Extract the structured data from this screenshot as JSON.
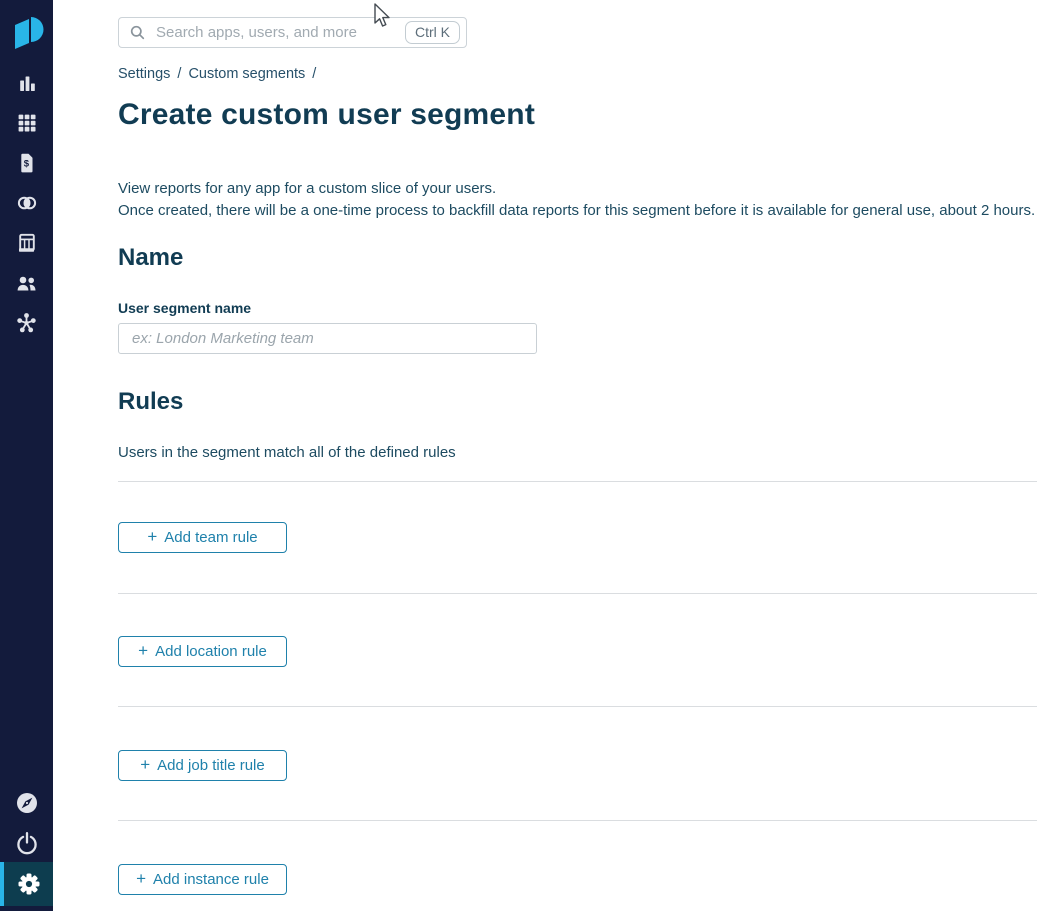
{
  "colors": {
    "sidebar_bg": "#131b3c",
    "sidebar_active_bg": "#0d3d4f",
    "accent_cyan": "#29b5e8",
    "heading_text": "#113c53",
    "body_text": "#1d4b61",
    "button_blue": "#1f81ab",
    "divider": "#dadde0"
  },
  "sidebar": {
    "logo_icon": "productiv-logo",
    "items": [
      {
        "id": "analytics",
        "icon": "bar-chart-icon"
      },
      {
        "id": "apps",
        "icon": "apps-grid-icon"
      },
      {
        "id": "spend",
        "icon": "invoice-dollar-icon"
      },
      {
        "id": "overlaps",
        "icon": "venn-diagram-icon"
      },
      {
        "id": "contracts",
        "icon": "receipt-icon"
      },
      {
        "id": "users",
        "icon": "users-icon"
      },
      {
        "id": "integrations",
        "icon": "hub-icon"
      }
    ],
    "footer_items": [
      {
        "id": "explore",
        "icon": "compass-icon",
        "active": false
      },
      {
        "id": "power",
        "icon": "power-icon",
        "active": false
      },
      {
        "id": "settings",
        "icon": "gear-icon",
        "active": true
      }
    ]
  },
  "search": {
    "icon": "search-icon",
    "placeholder": "Search apps, users, and more",
    "shortcut": "Ctrl K"
  },
  "breadcrumb": {
    "items": [
      "Settings",
      "Custom segments"
    ],
    "separator": "/"
  },
  "page": {
    "title": "Create custom user segment",
    "description": [
      "View reports for any app for a custom slice of your users.",
      "Once created, there will be a one-time process to backfill data reports for this segment before it is available for general use, about 2 hours."
    ]
  },
  "name_section": {
    "heading": "Name",
    "field_label": "User segment name",
    "field_value": "",
    "field_placeholder": "ex: London Marketing team"
  },
  "rules_section": {
    "heading": "Rules",
    "description": "Users in the segment match all of the defined rules",
    "add_buttons": [
      {
        "plus": "+",
        "label": "Add team rule"
      },
      {
        "plus": "+",
        "label": "Add location rule"
      },
      {
        "plus": "+",
        "label": "Add job title rule"
      },
      {
        "plus": "+",
        "label": "Add instance rule"
      }
    ]
  }
}
